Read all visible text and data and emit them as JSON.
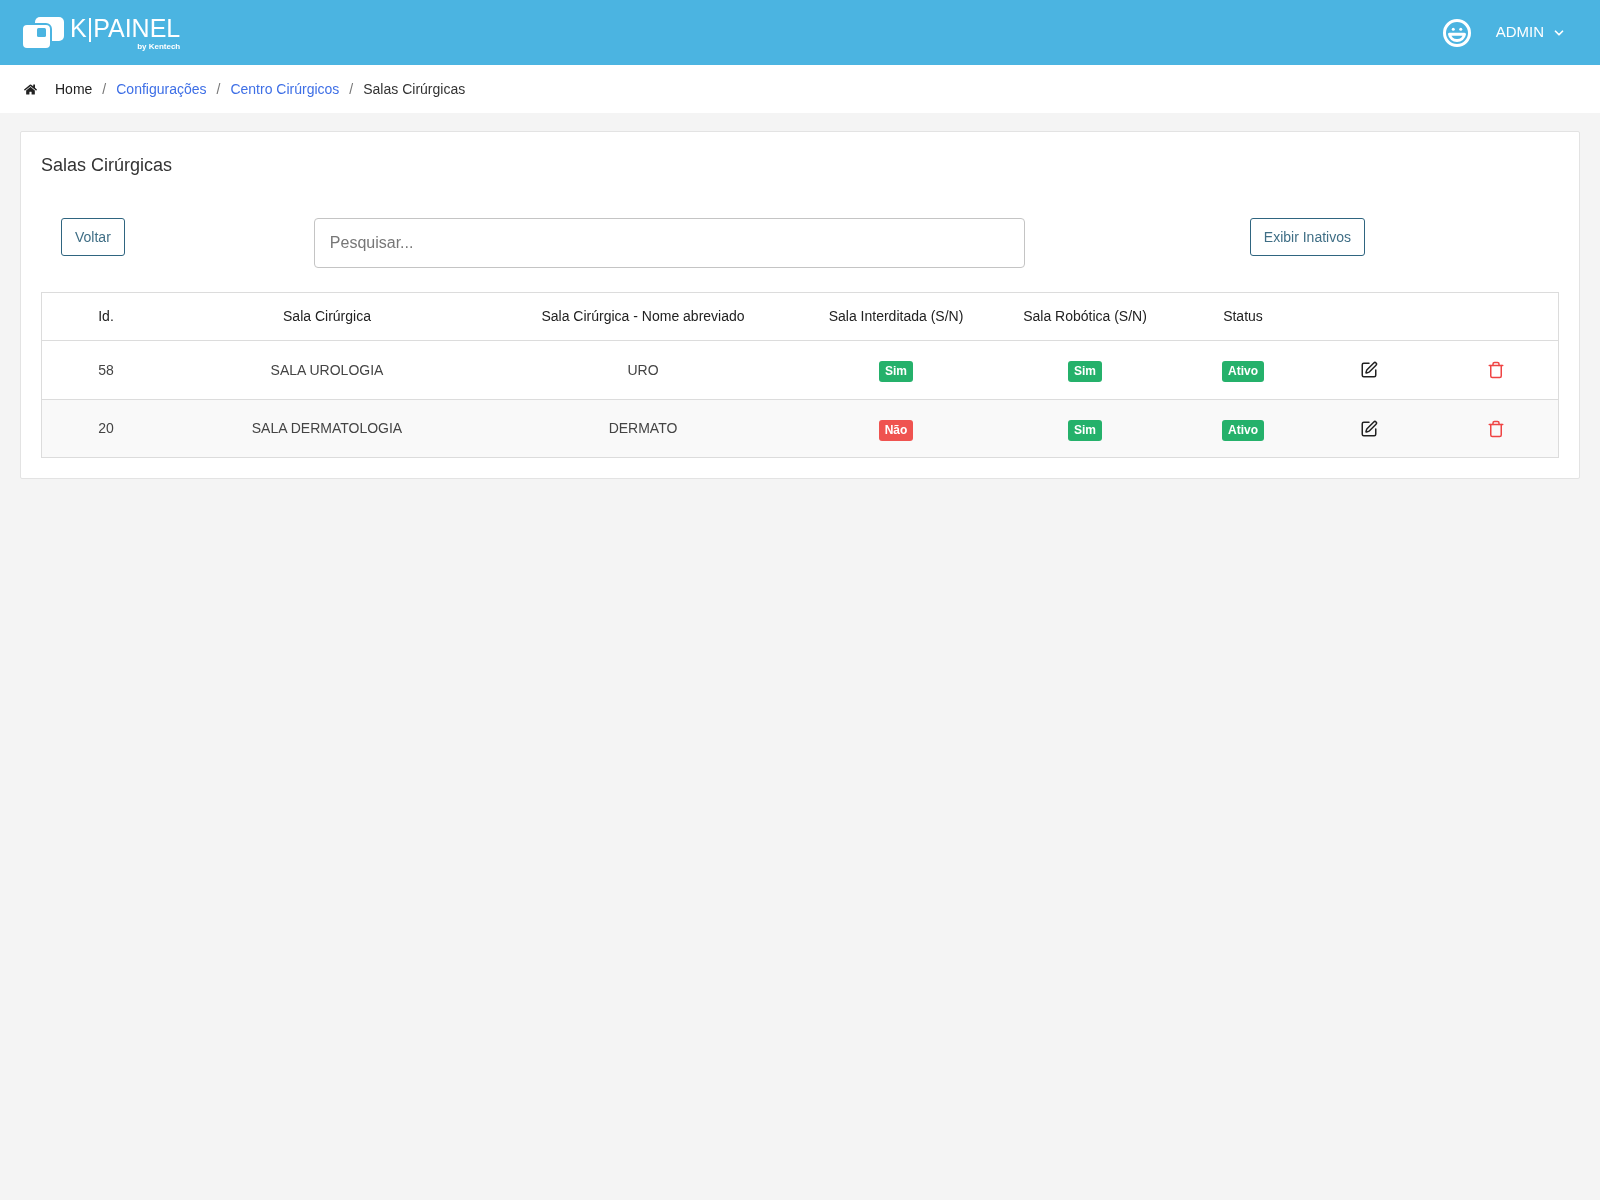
{
  "header": {
    "logo": {
      "wordmark": "K|PAINEL",
      "tagline": "by Kentech"
    },
    "user_menu": {
      "label": "ADMIN"
    }
  },
  "breadcrumb": [
    {
      "kind": "home",
      "label": "Home"
    },
    {
      "kind": "separator",
      "label": "/"
    },
    {
      "kind": "link",
      "label": "Configurações"
    },
    {
      "kind": "separator",
      "label": "/"
    },
    {
      "kind": "link",
      "label": "Centro Cirúrgicos"
    },
    {
      "kind": "separator",
      "label": "/"
    },
    {
      "kind": "current",
      "label": "Salas Cirúrgicas"
    }
  ],
  "card": {
    "title": "Salas Cirúrgicas",
    "back_button": "Voltar",
    "search": {
      "placeholder": "Pesquisar..."
    },
    "show_inactive_button": "Exibir Inativos",
    "table": {
      "columns": [
        "Id.",
        "Sala Cirúrgica",
        "Sala Cirúrgica - Nome abreviado",
        "Sala Interditada (S/N)",
        "Sala Robótica (S/N)",
        "Status"
      ],
      "rows": [
        {
          "id": "58",
          "name": "SALA UROLOGIA",
          "short_name": "URO",
          "interdicted": {
            "text": "Sim",
            "color": "#25b16b"
          },
          "robotic": {
            "text": "Sim",
            "color": "#25b16b"
          },
          "status": {
            "text": "Ativo",
            "color": "#25b16b"
          }
        },
        {
          "id": "20",
          "name": "SALA DERMATOLOGIA",
          "short_name": "DERMATO",
          "interdicted": {
            "text": "Não",
            "color": "#ef5350"
          },
          "robotic": {
            "text": "Sim",
            "color": "#25b16b"
          },
          "status": {
            "text": "Ativo",
            "color": "#25b16b"
          }
        }
      ]
    }
  }
}
